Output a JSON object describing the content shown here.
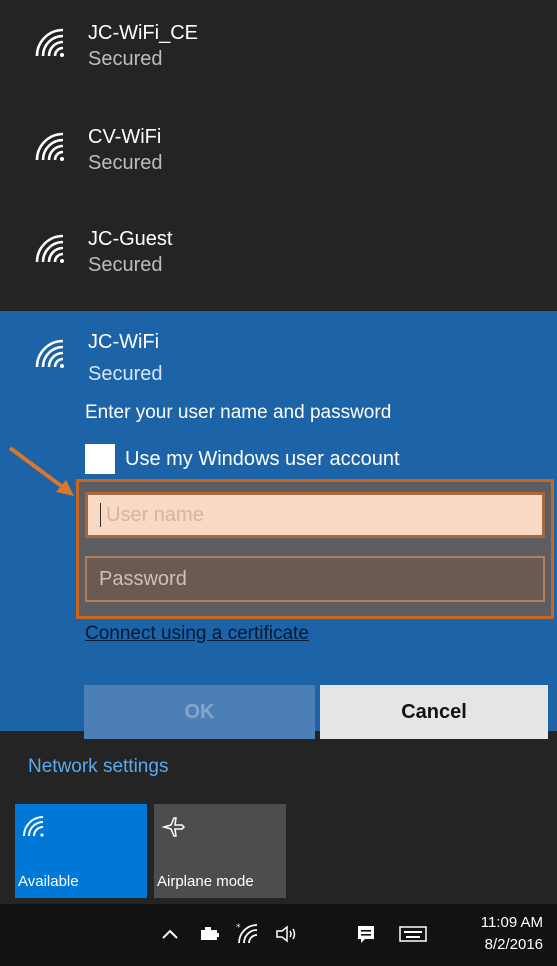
{
  "networks": [
    {
      "ssid": "JC-WiFi_CE",
      "status": "Secured",
      "icon": "wifi-icon"
    },
    {
      "ssid": "CV-WiFi",
      "status": "Secured",
      "icon": "wifi-icon"
    },
    {
      "ssid": "JC-Guest",
      "status": "Secured",
      "icon": "wifi-icon"
    }
  ],
  "selected": {
    "ssid": "JC-WiFi",
    "status": "Secured",
    "prompt": "Enter your user name and password",
    "checkbox_label": "Use my Windows user account",
    "username_placeholder": "User name",
    "password_placeholder": "Password",
    "cert_link": "Connect using a certificate",
    "ok_label": "OK",
    "cancel_label": "Cancel"
  },
  "network_settings": "Network settings",
  "tiles": {
    "available": {
      "label": "Available",
      "icon": "wifi-icon"
    },
    "airplane": {
      "label": "Airplane mode",
      "icon": "airplane-icon"
    }
  },
  "taskbar": {
    "time": "11:09 AM",
    "date": "8/2/2016",
    "icons": [
      "chevron-up-icon",
      "battery-icon",
      "wifi-icon",
      "volume-icon",
      "notifications-icon",
      "keyboard-icon"
    ]
  },
  "colors": {
    "selected_bg": "#1c63a8",
    "accent": "#0078d7",
    "highlight": "#c7671f"
  }
}
